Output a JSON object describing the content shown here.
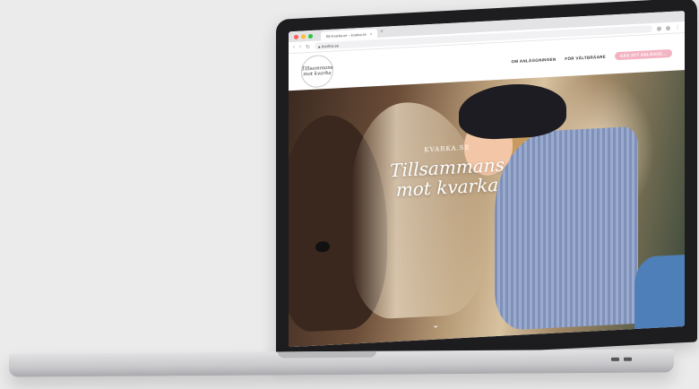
{
  "browser": {
    "tab_title": "Bli Kvarka.se – kvarka.se",
    "url": "kvarka.se"
  },
  "site": {
    "logo_text": "Tillsammans mot kvarka",
    "nav": [
      "OM ANLÄGGNINGEN",
      "FÖR VÄLTBRÄARE",
      "SÄG ATT ANLÄGGE..."
    ]
  },
  "hero": {
    "kicker": "KVARKA.SE",
    "title": "Tillsammans mot kvarka",
    "scroll_icon": "chevron-down-icon"
  },
  "colors": {
    "accent_pink": "#f3b3c2",
    "laptop_frame": "#1d1d1f"
  }
}
